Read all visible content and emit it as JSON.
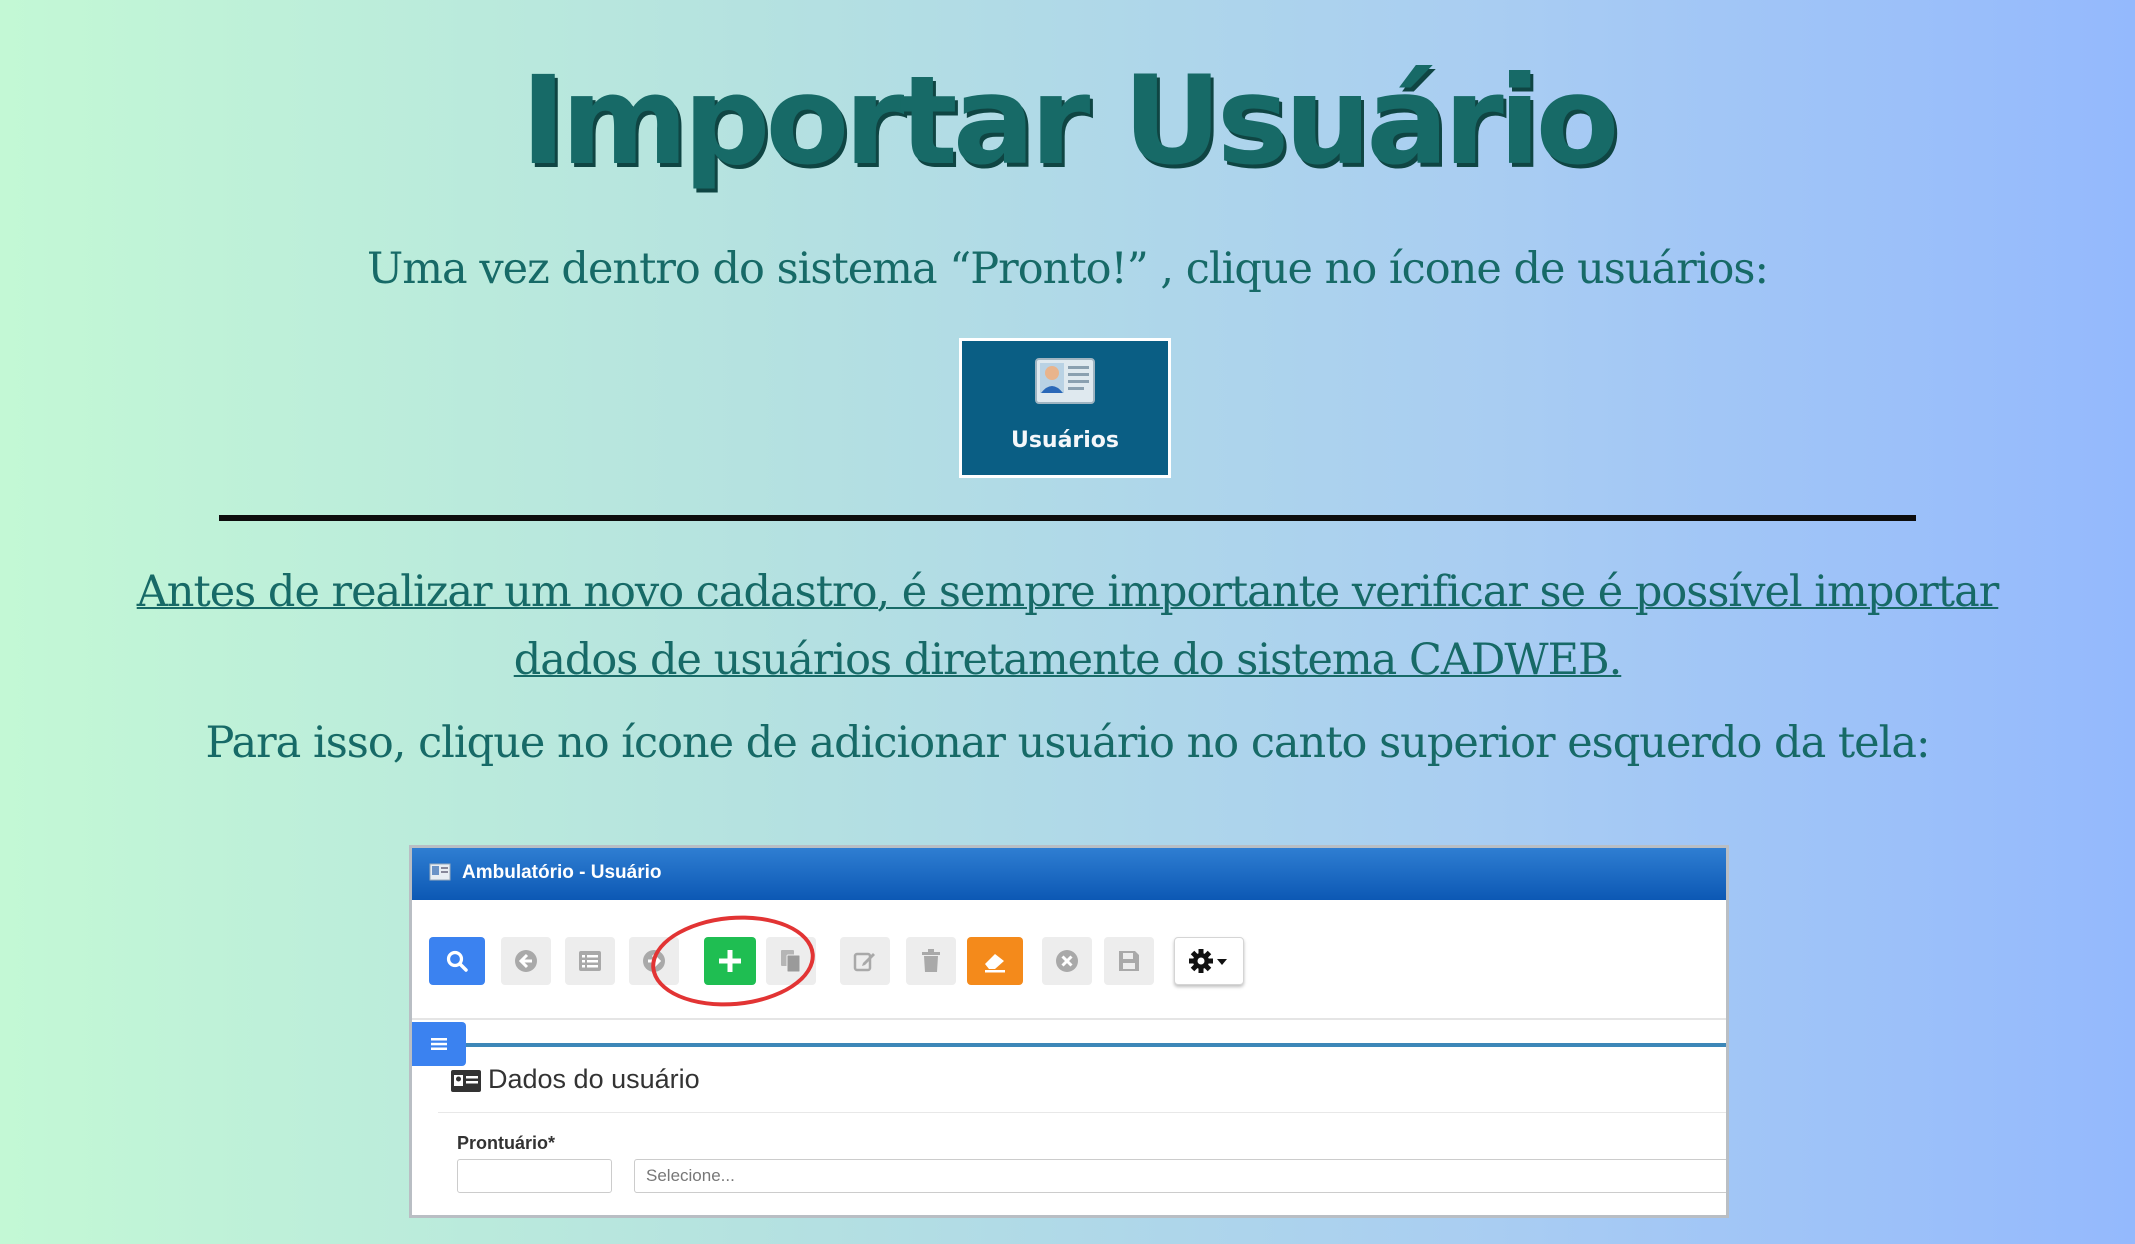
{
  "title": "Importar Usuário",
  "intro": "Uma vez dentro do sistema “Pronto!” , clique no ícone de usuários:",
  "tile": {
    "label": "Usuários",
    "icon": "user-card-icon"
  },
  "note": {
    "line1": "Antes de realizar um novo cadastro,  é sempre importante verificar se é possível importar",
    "line2": "dados de usuários diretamente do sistema CADWEB."
  },
  "instruction": "Para isso, clique no ícone de adicionar usuário no canto superior esquerdo da tela:",
  "window": {
    "title": "Ambulatório - Usuário",
    "toolbar": [
      {
        "name": "search-button",
        "icon": "search-icon",
        "color": "#3b82f0"
      },
      {
        "name": "back-button",
        "icon": "arrow-left-circle-icon"
      },
      {
        "name": "list-button",
        "icon": "list-icon"
      },
      {
        "name": "forward-button",
        "icon": "arrow-right-circle-icon"
      },
      {
        "name": "add-button",
        "icon": "plus-icon",
        "color": "#1fbe52"
      },
      {
        "name": "copy-button",
        "icon": "copy-icon"
      },
      {
        "name": "edit-button",
        "icon": "edit-icon"
      },
      {
        "name": "delete-button",
        "icon": "trash-icon"
      },
      {
        "name": "erase-button",
        "icon": "eraser-icon",
        "color": "#f48a1b"
      },
      {
        "name": "cancel-button",
        "icon": "close-circle-icon"
      },
      {
        "name": "save-button",
        "icon": "save-icon"
      },
      {
        "name": "settings-button",
        "icon": "gear-dropdown-icon"
      }
    ],
    "highlight_color": "#e23434",
    "section_title": "Dados do usuário",
    "field_label": "Prontuário*",
    "select_placeholder": "Selecione..."
  }
}
